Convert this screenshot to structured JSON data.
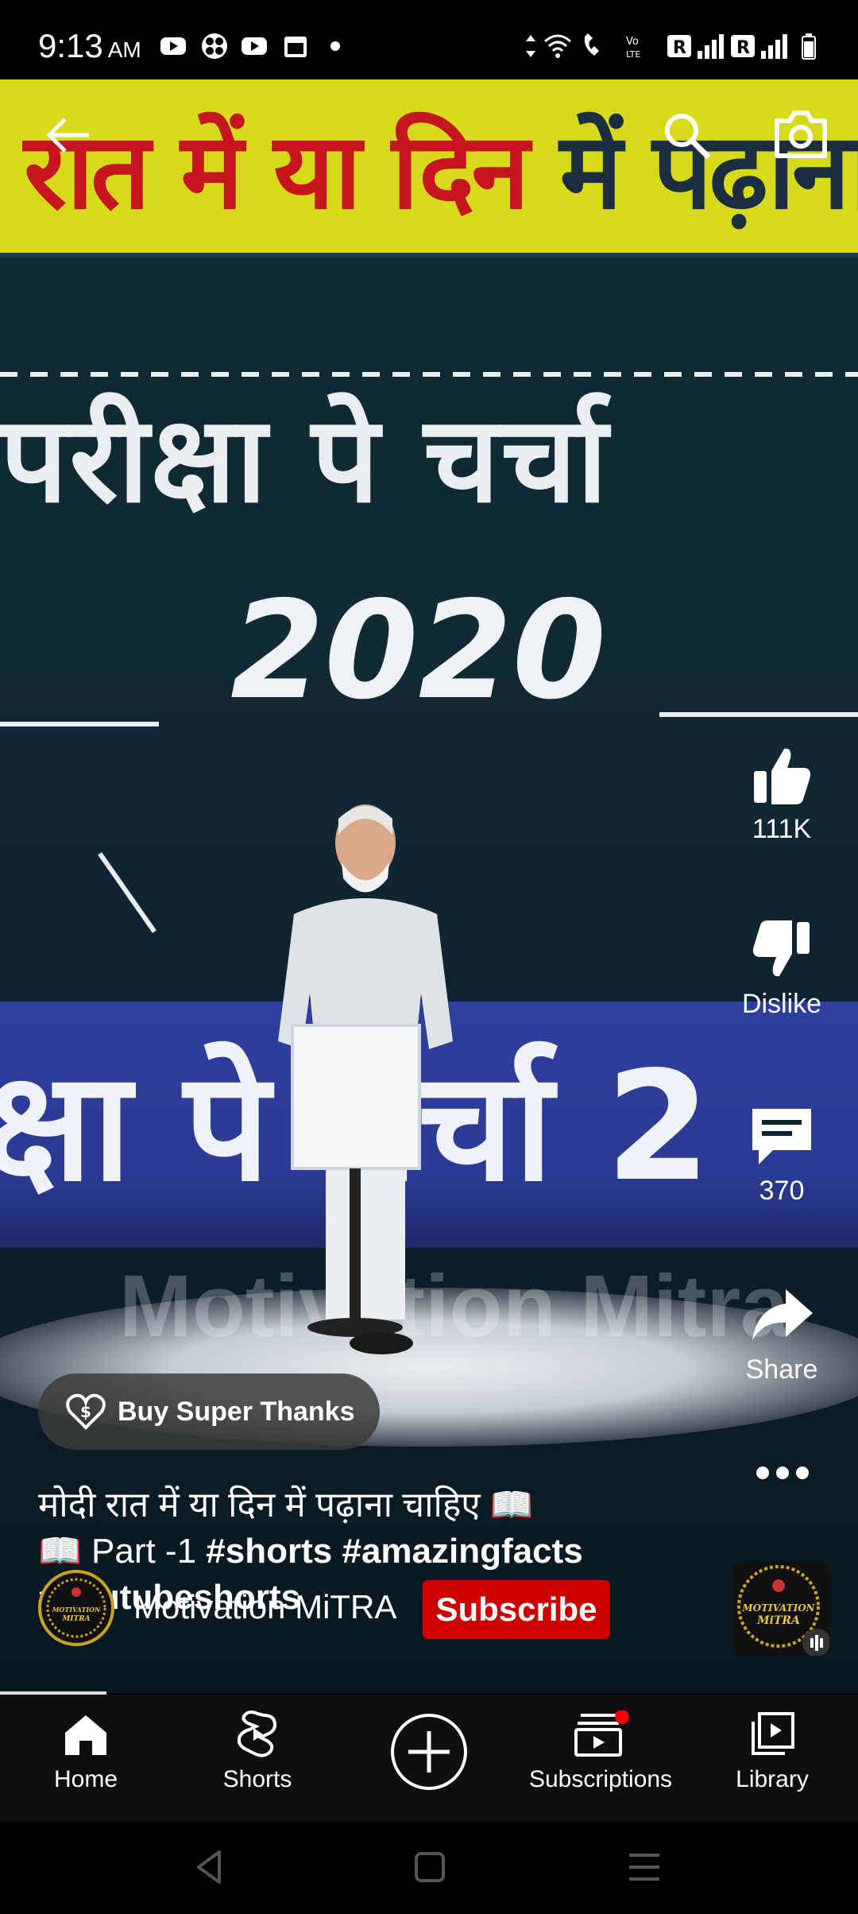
{
  "status_bar": {
    "time": "9:13",
    "am_pm": "AM"
  },
  "video": {
    "banner_red": "रात में या दिन",
    "banner_dark": " में पढ़ाना...",
    "title_hindi": "परीक्षा पे चर्चा",
    "year": "2020",
    "stage_text": "क्षा पे चर्चा 2",
    "watermark": "Motivation Mitra"
  },
  "rail": {
    "like_count": "111K",
    "dislike_label": "Dislike",
    "comment_count": "370",
    "share_label": "Share"
  },
  "super_thanks": {
    "label": "Buy Super Thanks"
  },
  "description": {
    "line1": "मोदी रात में या दिन में पढ़ाना चाहिए 📖",
    "part": "📖 Part -1 ",
    "tag1": "#shorts",
    "tag2": "#amazingfacts",
    "tag3": "#youtubeshorts"
  },
  "channel": {
    "name": "Motivation MiTRA",
    "avatar_text": "MOTIVATION MITRA",
    "subscribe_label": "Subscribe"
  },
  "bottom_nav": {
    "home": "Home",
    "shorts": "Shorts",
    "subscriptions": "Subscriptions",
    "library": "Library"
  },
  "colors": {
    "banner_bg": "#d7da1a",
    "banner_red": "#c4161c",
    "subscribe_red": "#cc0000",
    "notification_dot": "#ff0000"
  }
}
